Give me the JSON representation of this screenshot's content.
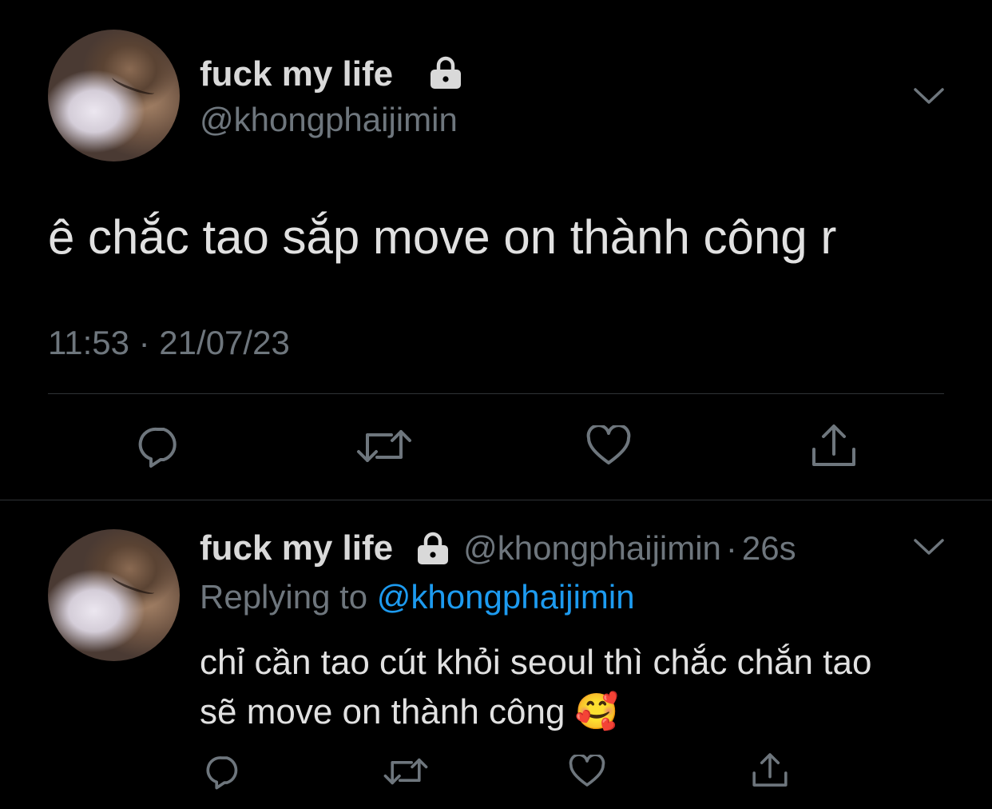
{
  "tweet": {
    "display_name": "fuck my life",
    "handle": "@khongphaijimin",
    "text": "ê chắc tao sắp move on thành công r",
    "timestamp": "11:53 · 21/07/23",
    "icons": [
      "lock-icon",
      "chevron-down-icon",
      "reply-icon",
      "retweet-icon",
      "like-icon",
      "share-icon"
    ]
  },
  "reply": {
    "display_name": "fuck my life",
    "handle": "@khongphaijimin",
    "separator": "·",
    "age": "26s",
    "replying_prefix": "Replying to ",
    "replying_handle": "@khongphaijimin",
    "text": "chỉ cần tao cút khỏi seoul thì chắc chắn tao sẽ move on thành công",
    "emoji": "🥰"
  },
  "colors": {
    "background": "#000000",
    "text": "#d9d9d9",
    "muted": "#6e767d",
    "link": "#1d9bf0",
    "divider": "#2f3336"
  }
}
